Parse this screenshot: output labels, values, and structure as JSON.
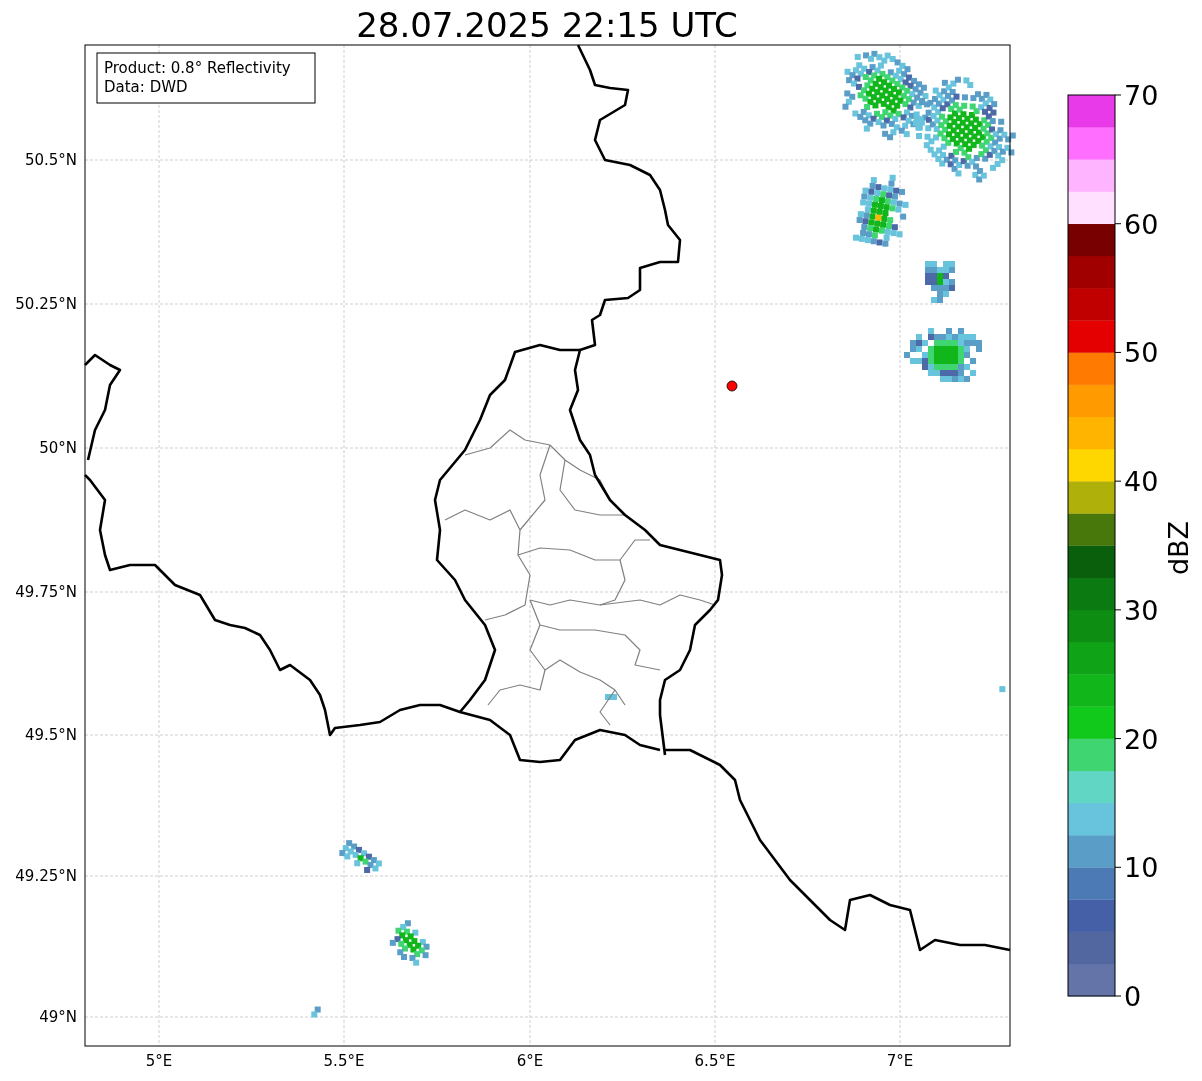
{
  "title": "28.07.2025 22:15 UTC",
  "annotation": [
    "Product: 0.8° Reflectivity",
    "Data: DWD"
  ],
  "lat_ticks": [
    "50.5°N",
    "50.25°N",
    "50°N",
    "49.75°N",
    "49.5°N",
    "49.25°N",
    "49°N"
  ],
  "lon_ticks": [
    "5°E",
    "5.5°E",
    "6°E",
    "6.5°E",
    "7°E"
  ],
  "colorbar": {
    "label": "dBZ",
    "ticks": [
      "70",
      "60",
      "50",
      "40",
      "30",
      "20",
      "10",
      "0"
    ],
    "steps": [
      {
        "color": "#6474a8"
      },
      {
        "color": "#5266a0"
      },
      {
        "color": "#4560a6"
      },
      {
        "color": "#4c7ab4"
      },
      {
        "color": "#5a9ec8"
      },
      {
        "color": "#68c3dc"
      },
      {
        "color": "#62d6c4"
      },
      {
        "color": "#3fd671"
      },
      {
        "color": "#10c91a"
      },
      {
        "color": "#10b61a"
      },
      {
        "color": "#0fa417"
      },
      {
        "color": "#0d8d12"
      },
      {
        "color": "#0b7a10"
      },
      {
        "color": "#0a5f0c"
      },
      {
        "color": "#48780c"
      },
      {
        "color": "#b0b00a"
      },
      {
        "color": "#ffd700"
      },
      {
        "color": "#ffb500"
      },
      {
        "color": "#ff9a00"
      },
      {
        "color": "#ff7a00"
      },
      {
        "color": "#e40000"
      },
      {
        "color": "#c00000"
      },
      {
        "color": "#a00000"
      },
      {
        "color": "#780000"
      },
      {
        "color": "#ffe0ff"
      },
      {
        "color": "#ffb4ff"
      },
      {
        "color": "#ff6eff"
      },
      {
        "color": "#e83ae8"
      }
    ]
  }
}
